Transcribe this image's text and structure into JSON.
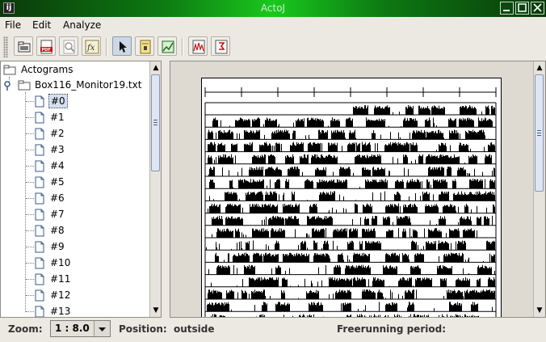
{
  "window": {
    "title": "ActoJ",
    "app_icon": "imagej-icon",
    "controls": [
      "minimize-icon",
      "maximize-icon",
      "close-icon"
    ]
  },
  "menu": {
    "items": [
      "File",
      "Edit",
      "Analyze"
    ]
  },
  "toolbar": {
    "buttons": [
      {
        "icon": "open-folder-icon"
      },
      {
        "icon": "pdf-export-icon"
      },
      {
        "icon": "zoom-icon"
      },
      {
        "icon": "function-icon"
      },
      {
        "icon": "pointer-icon",
        "active": true
      },
      {
        "icon": "notes-icon"
      },
      {
        "icon": "chart-icon"
      },
      {
        "icon": "periodogram-icon"
      },
      {
        "icon": "marker-icon"
      }
    ]
  },
  "tree": {
    "root": "Actograms",
    "file": "Box116_Monitor19.txt",
    "items": [
      "#0",
      "#1",
      "#2",
      "#3",
      "#4",
      "#5",
      "#6",
      "#7",
      "#8",
      "#9",
      "#10",
      "#11",
      "#12",
      "#13"
    ],
    "selected_index": 0
  },
  "status": {
    "zoom_label": "Zoom:",
    "zoom_value": "1 : 8.0",
    "position_label": "Position:",
    "position_value": "outside",
    "freerunning_label": "Freerunning period:",
    "freerunning_value": ""
  },
  "colors": {
    "titlebar_accent": "#19c81d",
    "selection": "#d5dff0",
    "tree_line": "#7d7d7d"
  }
}
